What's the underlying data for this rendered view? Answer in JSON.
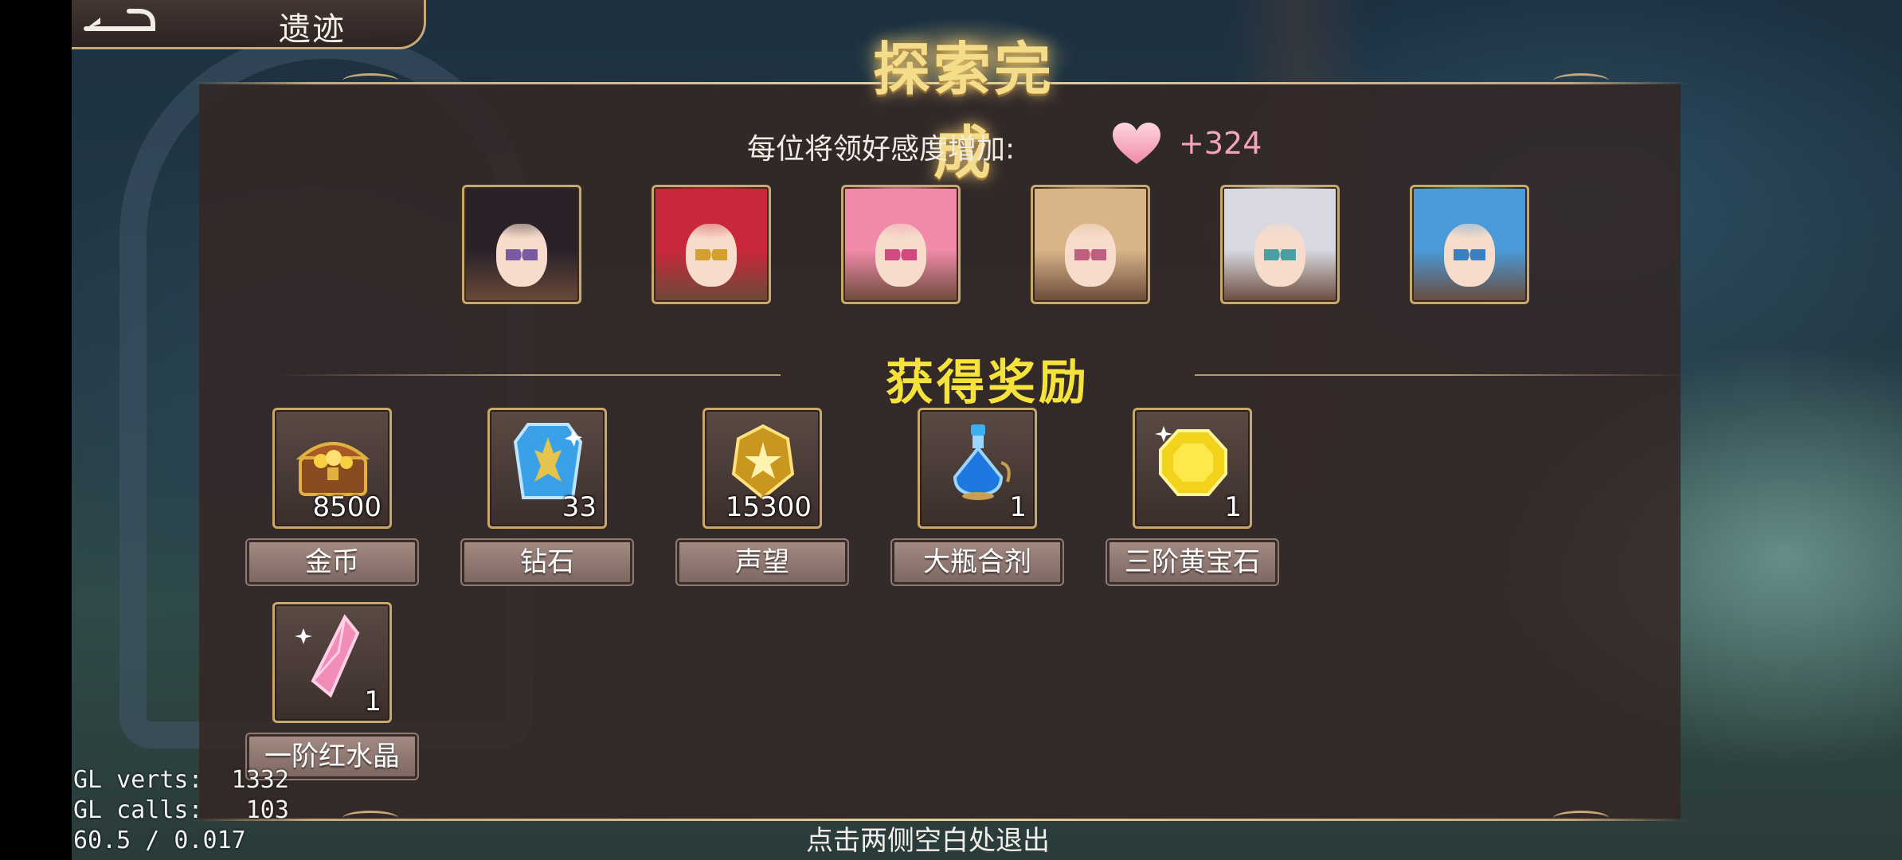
{
  "header": {
    "back_icon": "back-arrow-icon",
    "location": "遗迹"
  },
  "title": "探索完成",
  "affinity": {
    "label": "每位将领好感度增加:",
    "icon": "heart-icon",
    "value": "+324"
  },
  "portraits": [
    {
      "name": "portrait-1",
      "hair": "#2a2228",
      "eye": "#7a5aa0"
    },
    {
      "name": "portrait-2",
      "hair": "#c8283a",
      "eye": "#d4a030"
    },
    {
      "name": "portrait-3",
      "hair": "#f08aa8",
      "eye": "#d04a80"
    },
    {
      "name": "portrait-4",
      "hair": "#d8b488",
      "eye": "#c06080"
    },
    {
      "name": "portrait-5",
      "hair": "#d8d8e0",
      "eye": "#4aa0a0"
    },
    {
      "name": "portrait-6",
      "hair": "#4a9ad8",
      "eye": "#3a80c0"
    }
  ],
  "rewards_title": "获得奖励",
  "rewards": [
    {
      "name": "金币",
      "count": "8500",
      "icon": "treasure-chest-icon"
    },
    {
      "name": "钻石",
      "count": "33",
      "icon": "blue-crystal-icon"
    },
    {
      "name": "声望",
      "count": "15300",
      "icon": "gold-badge-icon"
    },
    {
      "name": "大瓶合剂",
      "count": "1",
      "icon": "potion-bottle-icon"
    },
    {
      "name": "三阶黄宝石",
      "count": "1",
      "icon": "yellow-gem-icon"
    },
    {
      "name": "一阶红水晶",
      "count": "1",
      "icon": "pink-crystal-icon"
    }
  ],
  "exit_hint": "点击两侧空白处退出",
  "debug": {
    "line1": "GL verts:  1332",
    "line2": "GL calls:   103",
    "line3": "60.5 / 0.017"
  },
  "colors": {
    "accent_gold": "#c9a86c",
    "rewards_title": "#f5e23a",
    "affinity_value": "#f3a6b8"
  }
}
